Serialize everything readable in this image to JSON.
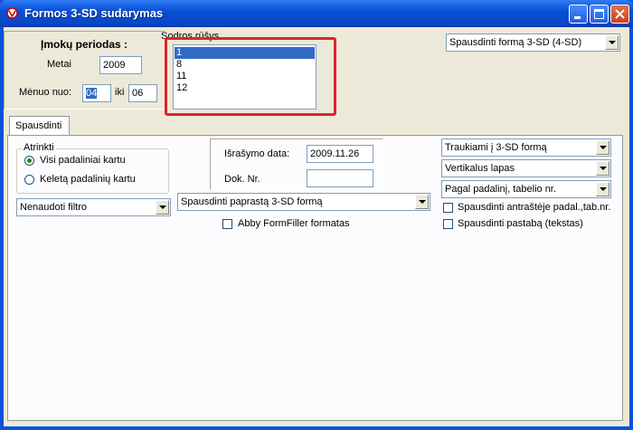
{
  "window": {
    "title": "Formos 3-SD sudarymas"
  },
  "period": {
    "heading": "Įmokų periodas :",
    "year_label": "Metai",
    "year_value": "2009",
    "month_from_label": "Mėnuo nuo:",
    "month_from_value": "04",
    "month_to_label": "iki",
    "month_to_value": "06"
  },
  "sodros_rusis": {
    "label": "Sodros rūšys",
    "items": [
      "1",
      "8",
      "11",
      "12"
    ],
    "selected_index": 0
  },
  "print_form_select": {
    "value": "Spausdinti formą 3-SD  (4-SD)"
  },
  "tab": {
    "label": "Spausdinti"
  },
  "atrinkti": {
    "label": "Atrinkti",
    "options": [
      "Visi padaliniai kartu",
      "Keletą padalinių kartu"
    ],
    "selected_index": 0
  },
  "filter_select": {
    "value": "Nenaudoti filtro"
  },
  "issue": {
    "date_label": "Išrašymo data:",
    "date_value": "2009.11.26",
    "doc_label": "Dok. Nr.",
    "doc_value": ""
  },
  "print_type_select": {
    "value": "Spausdinti paprastą 3-SD formą"
  },
  "abby_checkbox": {
    "label": "Abby FormFiller formatas",
    "checked": false
  },
  "right_options": {
    "include_select": "Traukiami į 3-SD formą",
    "orientation_select": "Vertikalus lapas",
    "sort_select": "Pagal padalinį, tabelio nr.",
    "header_checkbox": "Spausdinti antraštėje padal.,tab.nr.",
    "note_checkbox": "Spausdinti pastabą (tekstas)"
  }
}
